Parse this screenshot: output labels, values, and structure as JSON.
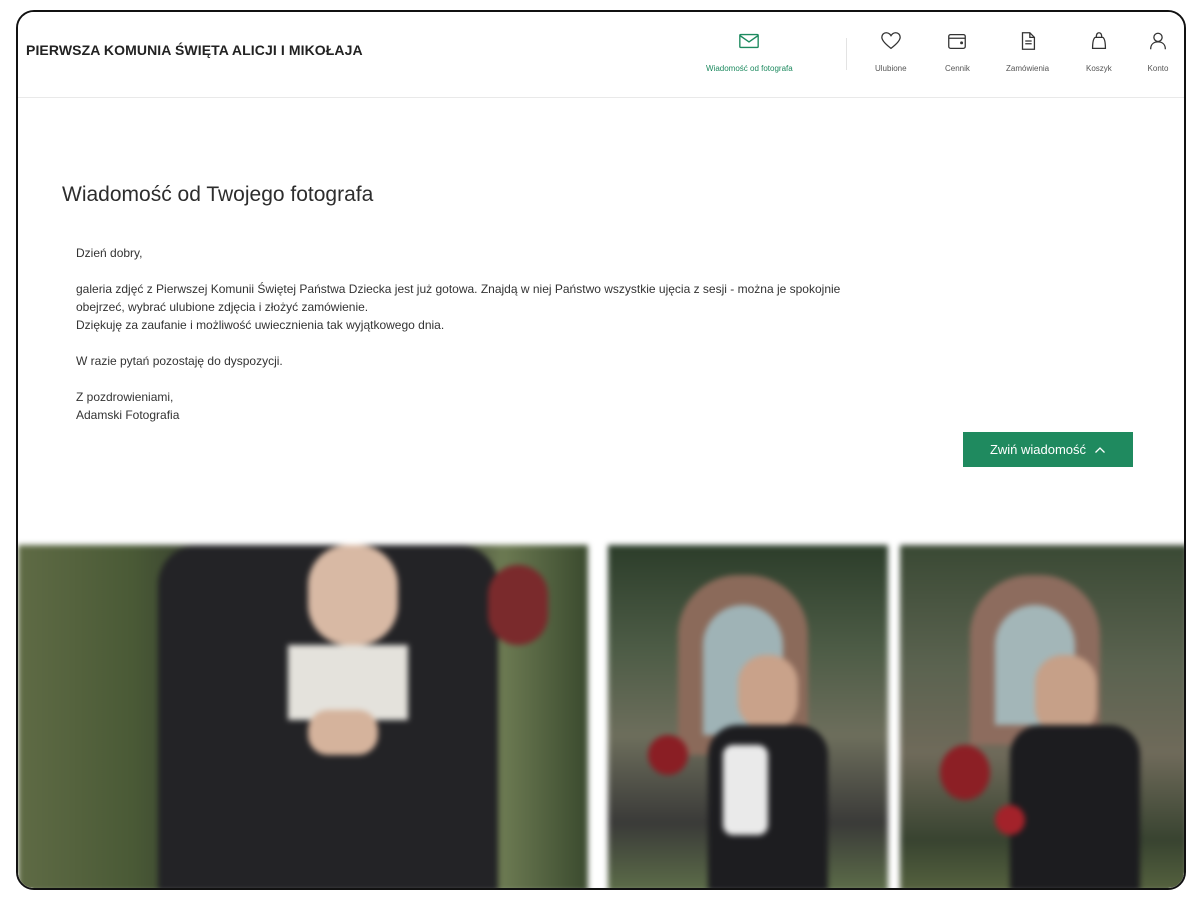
{
  "header": {
    "gallery_title": "PIERWSZA KOMUNIA ŚWIĘTA ALICJI I MIKOŁAJA",
    "nav": {
      "message": "Wiadomość od fotografa",
      "favorites": "Ulubione",
      "pricing": "Cennik",
      "orders": "Zamówienia",
      "cart": "Koszyk",
      "account": "Konto"
    },
    "accent_color": "#1d8a5f"
  },
  "message": {
    "heading": "Wiadomość od Twojego fotografa",
    "greeting": "Dzień dobry,",
    "line1": "galeria zdjęć z Pierwszej Komunii Świętej Państwa Dziecka jest już gotowa. Znajdą w niej Państwo wszystkie ujęcia z sesji - można je spokojnie",
    "line2": "obejrzeć, wybrać ulubione zdjęcia i złożyć zamówienie.",
    "line3": "Dziękuję za zaufanie i możliwość uwiecznienia tak wyjątkowego dnia.",
    "line4": "W razie pytań pozostaję do dyspozycji.",
    "closing": "Z pozdrowieniami,",
    "signature": "Adamski Fotografia",
    "collapse_label": "Zwiń wiadomość",
    "button_color": "#1f8a5f"
  },
  "icons": {
    "message": "envelope-icon",
    "favorites": "heart-icon",
    "pricing": "wallet-icon",
    "orders": "document-icon",
    "cart": "bag-icon",
    "account": "user-icon",
    "collapse": "chevron-up-icon"
  }
}
